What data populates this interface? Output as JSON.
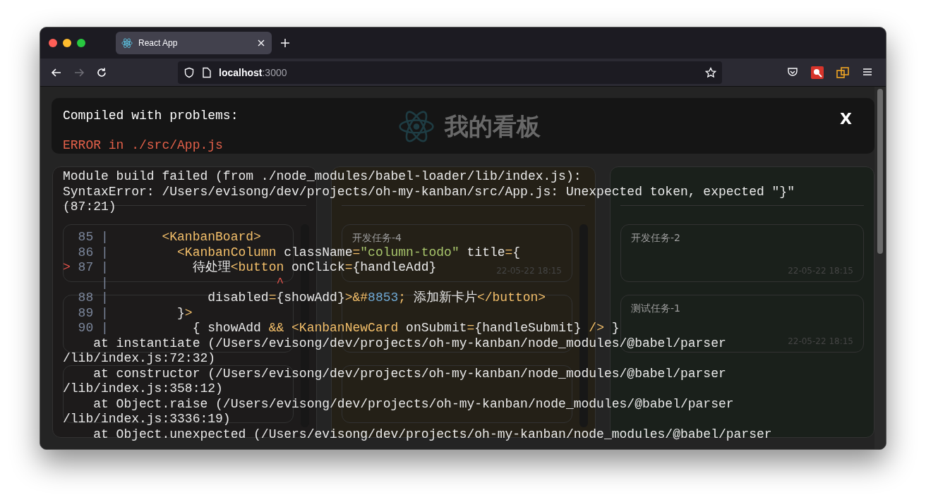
{
  "browser": {
    "tabs": [
      {
        "title": "React App",
        "selected": true
      }
    ],
    "nav": [
      {
        "kind": "back",
        "disabled": false
      },
      {
        "kind": "forward",
        "disabled": true
      },
      {
        "kind": "reload",
        "disabled": false
      }
    ],
    "address": {
      "host": "localhost",
      "port": ":3000"
    }
  },
  "page": {
    "title": "我的看板",
    "columns": [
      {
        "kind": "todo",
        "cards": [
          {
            "kind": "card"
          },
          {
            "kind": "card"
          },
          {
            "kind": "card"
          }
        ]
      },
      {
        "kind": "doing",
        "cards": [
          {
            "kind": "card",
            "title": "开发任务-4",
            "time": "22-05-22 18:15"
          },
          {
            "kind": "card"
          },
          {
            "kind": "card"
          }
        ]
      },
      {
        "kind": "done",
        "cards": [
          {
            "kind": "card",
            "title": "开发任务-2",
            "time": "22-05-22 18:15"
          },
          {
            "kind": "card",
            "title": "测试任务-1",
            "time": "22-05-22 18:15"
          }
        ]
      }
    ]
  },
  "overlay": {
    "heading": "Compiled with problems:",
    "error": "ERROR in ./src/App.js",
    "close": "X",
    "message": [
      "Module build failed (from ./node_modules/babel-loader/lib/index.js):",
      "SyntaxError: /Users/evisong/dev/projects/oh-my-kanban/src/App.js: Unexpected token, expected \"}\"",
      "(87:21)"
    ],
    "code_frame": [
      {
        "kind": "code",
        "gutter": "85 |",
        "segments": [
          {
            "t": "      <KanbanBoard>",
            "kind": "tag"
          }
        ]
      },
      {
        "kind": "code",
        "gutter": "86 |",
        "segments": [
          {
            "t": "        <KanbanColumn",
            "kind": "tag"
          },
          {
            "t": " className",
            "kind": "plain"
          },
          {
            "t": "=",
            "kind": "tag"
          },
          {
            "t": "\"column-todo\"",
            "kind": "string"
          },
          {
            "t": " title",
            "kind": "plain"
          },
          {
            "t": "=",
            "kind": "tag"
          },
          {
            "t": "{",
            "kind": "plain"
          }
        ]
      },
      {
        "kind": "code",
        "marker": ">",
        "gutter": "87 |",
        "segments": [
          {
            "t": "          待处理",
            "kind": "plain"
          },
          {
            "t": "<button",
            "kind": "tag"
          },
          {
            "t": " onClick",
            "kind": "plain"
          },
          {
            "t": "=",
            "kind": "tag"
          },
          {
            "t": "{handleAdd}",
            "kind": "plain"
          }
        ]
      },
      {
        "kind": "caret",
        "gutter": "|",
        "caret": "^"
      },
      {
        "kind": "code",
        "gutter": "88 |",
        "segments": [
          {
            "t": "            disabled",
            "kind": "plain"
          },
          {
            "t": "=",
            "kind": "tag"
          },
          {
            "t": "{showAdd}",
            "kind": "plain"
          },
          {
            "t": ">&#",
            "kind": "tag"
          },
          {
            "t": "8853",
            "kind": "number"
          },
          {
            "t": ";",
            "kind": "tag"
          },
          {
            "t": " 添加新卡片",
            "kind": "plain"
          },
          {
            "t": "</button>",
            "kind": "tag"
          }
        ]
      },
      {
        "kind": "code",
        "gutter": "89 |",
        "segments": [
          {
            "t": "        }",
            "kind": "plain"
          },
          {
            "t": ">",
            "kind": "tag"
          }
        ]
      },
      {
        "kind": "code",
        "gutter": "90 |",
        "segments": [
          {
            "t": "          { showAdd ",
            "kind": "plain"
          },
          {
            "t": "&& <KanbanNewCard",
            "kind": "tag"
          },
          {
            "t": " onSubmit",
            "kind": "plain"
          },
          {
            "t": "=",
            "kind": "tag"
          },
          {
            "t": "{handleSubmit} ",
            "kind": "plain"
          },
          {
            "t": "/>",
            "kind": "tag"
          },
          {
            "t": " }",
            "kind": "plain"
          }
        ]
      }
    ],
    "frames": [
      {
        "call": "at instantiate (/Users/evisong/dev/projects/oh-my-kanban/node_modules/@babel/parser",
        "cont": "/lib/index.js:72:32)"
      },
      {
        "call": "at constructor (/Users/evisong/dev/projects/oh-my-kanban/node_modules/@babel/parser",
        "cont": "/lib/index.js:358:12)"
      },
      {
        "call": "at Object.raise (/Users/evisong/dev/projects/oh-my-kanban/node_modules/@babel/parser",
        "cont": "/lib/index.js:3336:19)"
      },
      {
        "call": "at Object.unexpected (/Users/evisong/dev/projects/oh-my-kanban/node_modules/@babel/parser"
      }
    ]
  }
}
